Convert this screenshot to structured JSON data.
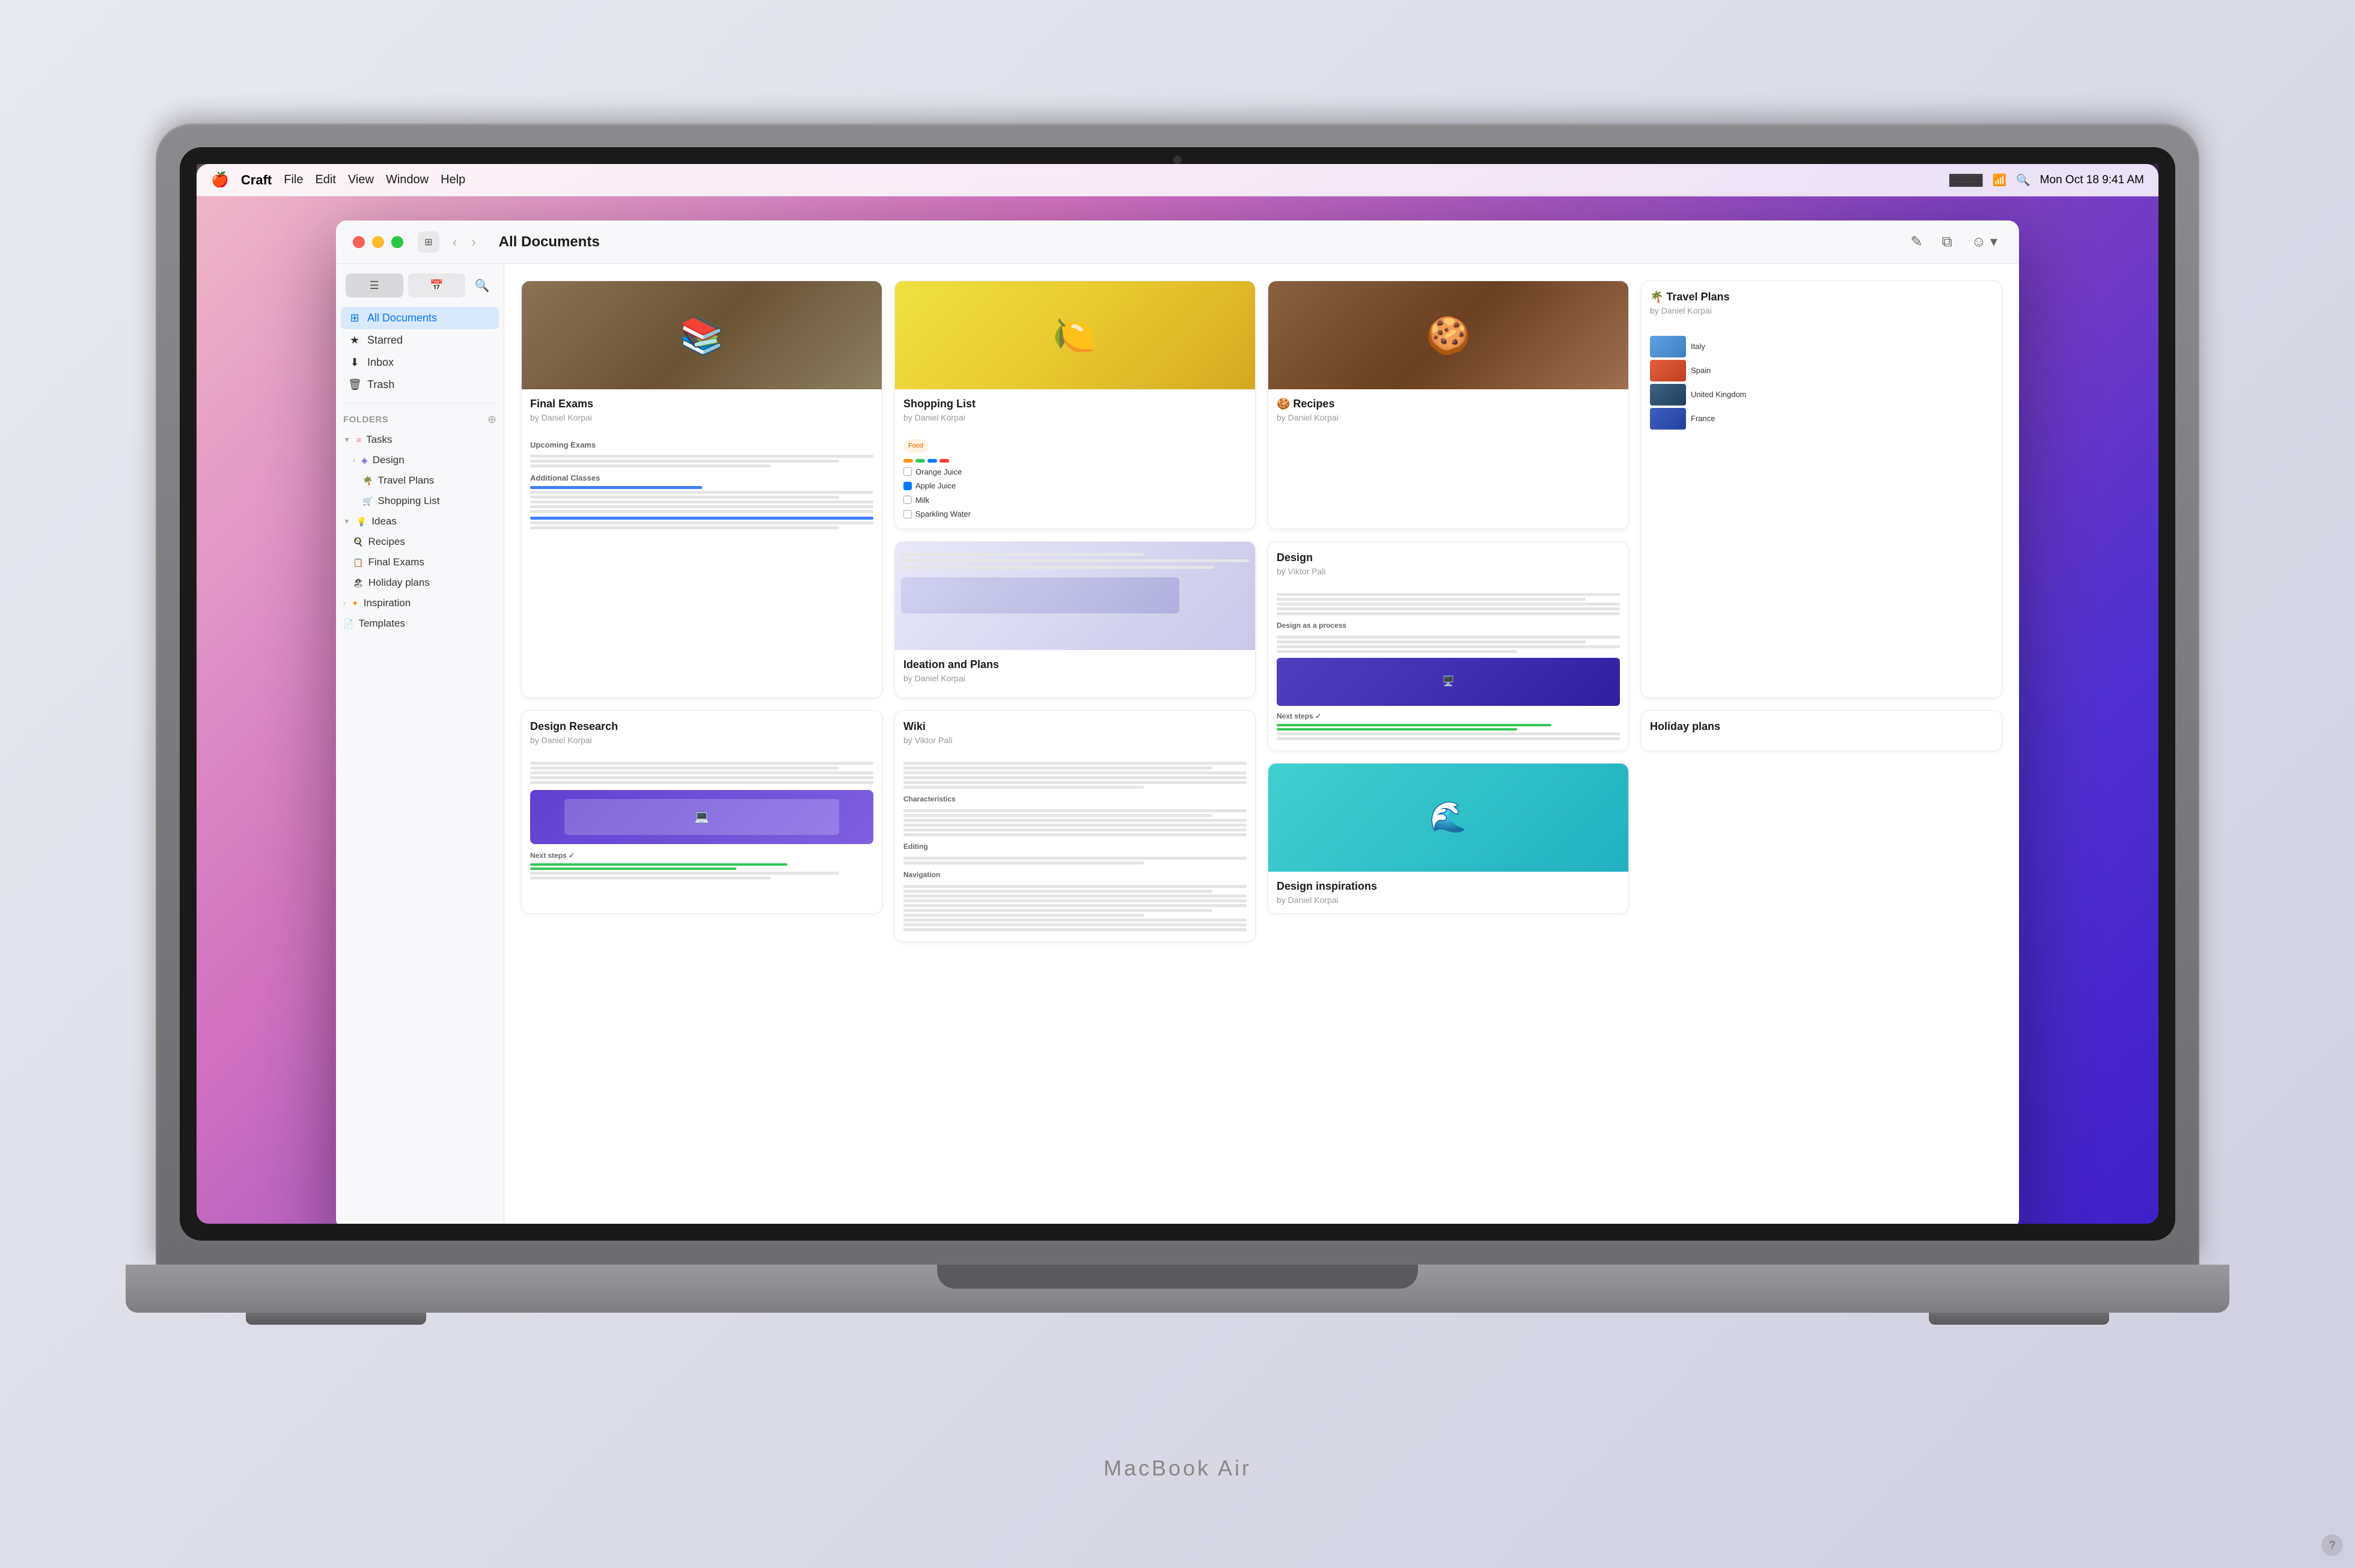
{
  "menubar": {
    "apple_logo": "🍎",
    "app_name": "Craft",
    "menus": [
      "File",
      "Edit",
      "View",
      "Window",
      "Help"
    ],
    "right_items": [
      "Mon Oct 18",
      "9:41 AM"
    ]
  },
  "window": {
    "title": "All Documents",
    "sidebar_toggle_icon": "⊞",
    "nav_back": "‹",
    "nav_forward": "›",
    "action_icons": [
      "✎",
      "⧉",
      "☺"
    ]
  },
  "sidebar": {
    "nav_items": [
      {
        "id": "all-documents",
        "icon": "⊞",
        "label": "All Documents",
        "active": true
      },
      {
        "id": "starred",
        "icon": "★",
        "label": "Starred"
      },
      {
        "id": "inbox",
        "icon": "↓",
        "label": "Inbox"
      },
      {
        "id": "trash",
        "icon": "🗑",
        "label": "Trash"
      }
    ],
    "folders_section": "Folders",
    "folders": [
      {
        "id": "tasks",
        "icon": "≡",
        "label": "Tasks",
        "expanded": true,
        "color": "#ff6b6b",
        "indent": 0
      },
      {
        "id": "design",
        "icon": "◈",
        "label": "Design",
        "indent": 1
      },
      {
        "id": "travel-plans",
        "icon": "🌴",
        "label": "Travel Plans",
        "indent": 2
      },
      {
        "id": "shopping-list",
        "icon": "🛒",
        "label": "Shopping List",
        "indent": 2
      },
      {
        "id": "ideas",
        "icon": "💡",
        "label": "Ideas",
        "expanded": true,
        "indent": 0
      },
      {
        "id": "recipes",
        "icon": "🍳",
        "label": "Recipes",
        "indent": 1
      },
      {
        "id": "final-exams",
        "icon": "📋",
        "label": "Final Exams",
        "indent": 1
      },
      {
        "id": "holiday-plans",
        "icon": "🏖",
        "label": "Holiday plans",
        "indent": 1
      },
      {
        "id": "inspiration",
        "icon": "✦",
        "label": "Inspiration",
        "indent": 0
      },
      {
        "id": "templates",
        "icon": "📄",
        "label": "Templates",
        "indent": 0
      }
    ]
  },
  "documents": [
    {
      "id": "final-exams",
      "title": "Final Exams",
      "author": "by Daniel Korpai",
      "thumb_type": "books",
      "thumb_emoji": "📚",
      "span_rows": true
    },
    {
      "id": "shopping-list",
      "title": "Shopping List",
      "author": "by Daniel Korpai",
      "thumb_type": "lemons",
      "thumb_emoji": "🍋"
    },
    {
      "id": "recipes",
      "title": "🍪 Recipes",
      "author": "by Daniel Korpai",
      "thumb_type": "cookies",
      "thumb_emoji": "🍪"
    },
    {
      "id": "travel-plans",
      "title": "🌴 Travel Plans",
      "author": "by Daniel Korpai",
      "thumb_type": "travel",
      "span_rows": true
    },
    {
      "id": "ideation-plans",
      "title": "Ideation and Plans",
      "author": "by Daniel Korpai",
      "thumb_type": "ideas"
    },
    {
      "id": "design",
      "title": "Design",
      "author": "by Viktor Pali",
      "thumb_type": "design",
      "span_rows": true
    },
    {
      "id": "design-research",
      "title": "Design Research",
      "author": "by Daniel Korpai",
      "thumb_type": "design_research",
      "span_rows": true
    },
    {
      "id": "wiki",
      "title": "Wiki",
      "author": "by Viktor Pali",
      "thumb_type": "wiki",
      "span_rows": true
    },
    {
      "id": "holiday-plans",
      "title": "Holiday plans",
      "author": "",
      "thumb_type": "holiday"
    },
    {
      "id": "design-inspirations",
      "title": "Design inspirations",
      "author": "by Daniel Korpai",
      "thumb_type": "inspirations"
    }
  ],
  "help_button": "?"
}
